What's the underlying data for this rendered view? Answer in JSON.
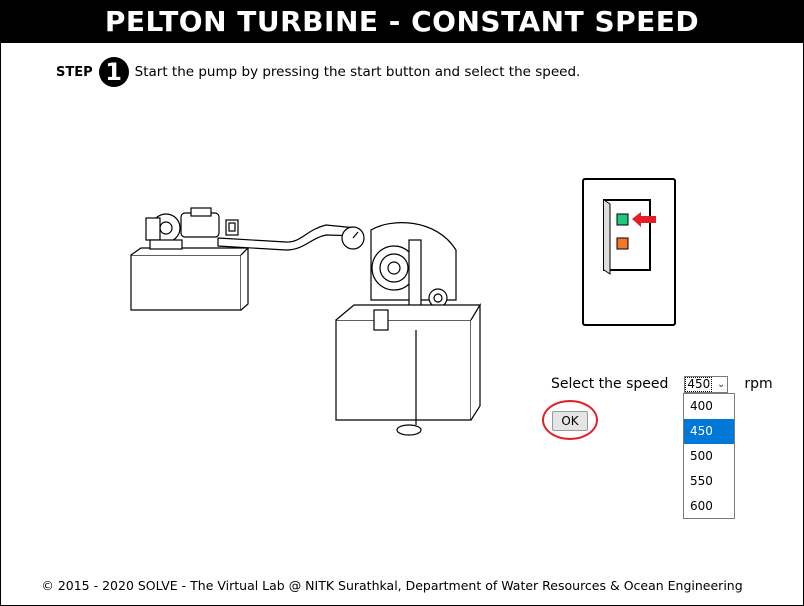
{
  "header": {
    "title": "PELTON TURBINE - CONSTANT SPEED"
  },
  "step": {
    "label": "STEP",
    "number": "1",
    "instruction": "Start the pump by pressing the start button and select the speed."
  },
  "control_panel": {
    "start_color": "#1fc87a",
    "stop_color": "#f07828",
    "pointer_color": "#e31e24"
  },
  "speed": {
    "label": "Select the speed",
    "selected": "450",
    "unit": "rpm",
    "options": [
      "400",
      "450",
      "500",
      "550",
      "600"
    ]
  },
  "ok_button": {
    "label": "OK"
  },
  "footer": {
    "text": "© 2015 - 2020 SOLVE - The Virtual Lab @ NITK Surathkal, Department of Water Resources & Ocean Engineering"
  }
}
